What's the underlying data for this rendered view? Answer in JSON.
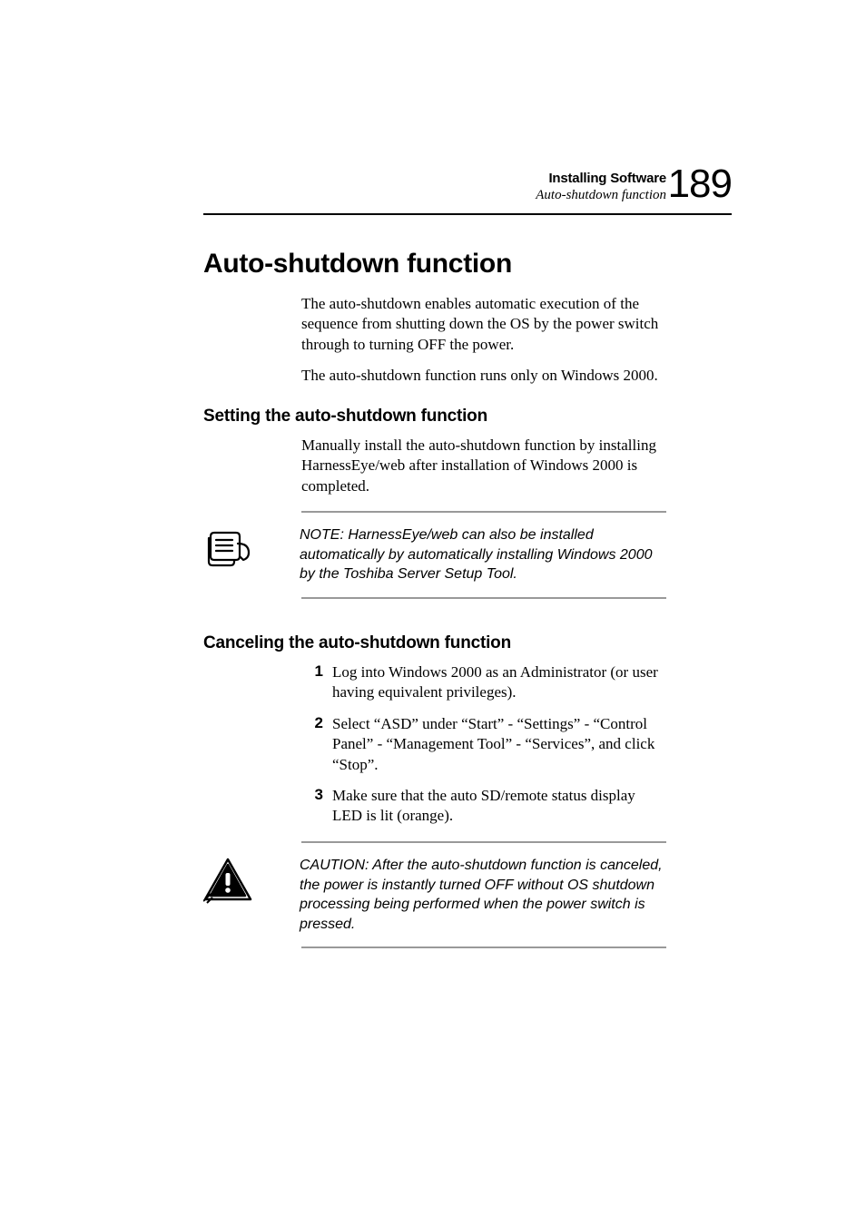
{
  "header": {
    "chapter": "Installing Software",
    "section": "Auto-shutdown function",
    "page_number": "189"
  },
  "title": "Auto-shutdown function",
  "intro": {
    "p1": "The auto-shutdown enables automatic execution of the sequence from shutting down the OS by the power switch through to turning OFF the power.",
    "p2": "The auto-shutdown function runs only on Windows 2000."
  },
  "setting": {
    "heading": "Setting the auto-shutdown function",
    "p1": "Manually install the auto-shutdown function by installing HarnessEye/web after installation of Windows 2000 is completed."
  },
  "note": {
    "text": "NOTE: HarnessEye/web can also be installed automatically by automatically installing Windows 2000 by the Toshiba Server Setup Tool."
  },
  "canceling": {
    "heading": "Canceling the auto-shutdown function",
    "steps": [
      "Log into Windows 2000 as an Administrator (or user having equivalent privileges).",
      "Select “ASD” under “Start” - “Settings” - “Control Panel” - “Management Tool” - “Services”, and click “Stop”.",
      "Make sure that the auto SD/remote status display LED is lit (orange)."
    ]
  },
  "caution": {
    "text": "CAUTION: After the auto-shutdown function is canceled, the power is instantly turned OFF without OS shutdown processing being performed when the power switch is pressed."
  }
}
